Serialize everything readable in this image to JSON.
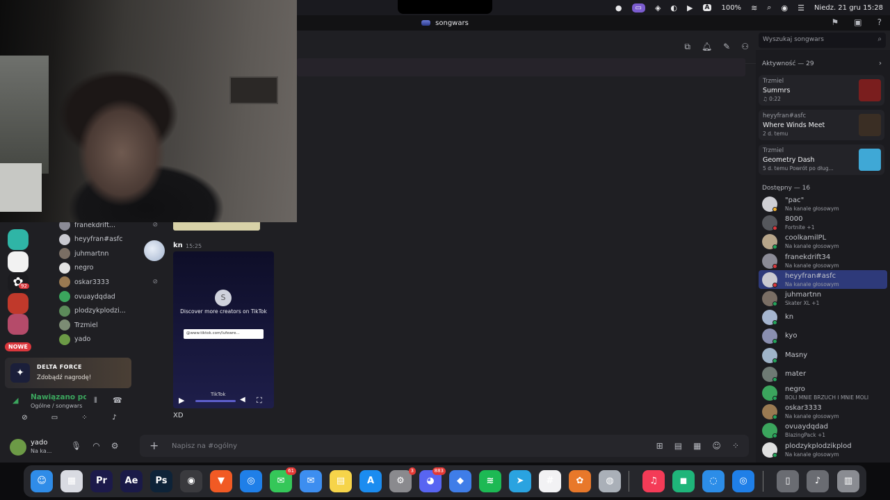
{
  "menubar": {
    "battery": "100%",
    "datetime": "Niedz. 21 gru  15:28",
    "input_source": "A"
  },
  "window": {
    "title": "songwars"
  },
  "search": {
    "placeholder": "Wyszukaj songwars"
  },
  "rail": {
    "badge": "92",
    "nowe": "NOWE"
  },
  "channel_members": [
    {
      "name": "franekdrift...",
      "muted": true,
      "color": "#8b8b96"
    },
    {
      "name": "heyyfran#asfc",
      "muted": false,
      "color": "#c9c9d0"
    },
    {
      "name": "juhmartnn",
      "muted": true,
      "color": "#7a6e64"
    },
    {
      "name": "negro",
      "muted": false,
      "color": "#e2e2e2"
    },
    {
      "name": "oskar3333",
      "muted": true,
      "color": "#9a7a52"
    },
    {
      "name": "ovuaydqdad",
      "muted": false,
      "color": "#3ba55d"
    },
    {
      "name": "plodzykplodzi...",
      "muted": false,
      "color": "#5c8a5a"
    },
    {
      "name": "Trzmiel",
      "muted": false,
      "color": "#7c8c74"
    },
    {
      "name": "yado",
      "muted": false,
      "color": "#6c9a46"
    }
  ],
  "ad": {
    "title": "DELTA FORCE",
    "subtitle": "Zdobądź nagrodę!"
  },
  "voice": {
    "status": "Nawiązano połą",
    "channel": "Ogólne / songwars"
  },
  "user": {
    "name": "yado",
    "status": "Na ka..."
  },
  "message": {
    "author": "kn",
    "time": "15:25",
    "video_heading": "Discover more creators on TikTok",
    "video_url": "@www.tiktok.com/lufewre...",
    "video_brand": "TikTok",
    "video_initial": "S",
    "text": "XD"
  },
  "composer": {
    "placeholder": "Napisz na #ogólny"
  },
  "activity": {
    "title": "Aktywność — 29",
    "cards": [
      {
        "who": "Trzmiel",
        "game": "Summrs",
        "meta": "♫ 0:22",
        "thumb": "#7a1e1e"
      },
      {
        "who": "heyyfran#asfc",
        "game": "Where Winds Meet",
        "meta": "2 d. temu",
        "thumb": "#3a2e24"
      },
      {
        "who": "Trzmiel",
        "game": "Geometry Dash",
        "meta": "5 d. temu   Powrót po dług...",
        "thumb": "#3fa8d6"
      }
    ]
  },
  "available": {
    "title": "Dostępny — 16",
    "members": [
      {
        "name": "\"pac\"",
        "status": "Na kanale głosowym",
        "color": "#cfcfd4",
        "dot": "#f0b232"
      },
      {
        "name": "8000",
        "status": "Fortnite +1",
        "color": "#55575c",
        "dot": "#da373c"
      },
      {
        "name": "coolkamilPL",
        "status": "Na kanale głosowym",
        "color": "#b7a58a",
        "dot": "#23a55a"
      },
      {
        "name": "franekdrift34",
        "status": "Na kanale głosowym",
        "color": "#8b8b96",
        "dot": "#da373c"
      },
      {
        "name": "heyyfran#asfc",
        "status": "Na kanale głosowym",
        "color": "#c9c9d0",
        "dot": "#da373c",
        "highlight": true
      },
      {
        "name": "juhmartnn",
        "status": "Skater XL +1",
        "color": "#7a6e64",
        "dot": "#23a55a"
      },
      {
        "name": "kn",
        "status": "",
        "color": "#a5b5cf",
        "dot": "#23a55a"
      },
      {
        "name": "kyo",
        "status": "",
        "color": "#8a8fb0",
        "dot": "#23a55a"
      },
      {
        "name": "Masny",
        "status": "",
        "color": "#9fb4c9",
        "dot": "#23a55a"
      },
      {
        "name": "mater",
        "status": "",
        "color": "#6e7a74",
        "dot": "#23a55a"
      },
      {
        "name": "negro",
        "status": "BOLI MNIE BRZUCH I MNIE MOLI",
        "color": "#3ba55d",
        "dot": "#23a55a"
      },
      {
        "name": "oskar3333",
        "status": "Na kanale głosowym",
        "color": "#9a7a52",
        "dot": "#23a55a"
      },
      {
        "name": "ovuaydqdad",
        "status": "BlazingPack +1",
        "color": "#3ba55d",
        "dot": "#23a55a"
      },
      {
        "name": "plodzykplodzikplod",
        "status": "Na kanale głosowym",
        "color": "#e0e0e0",
        "dot": "#23a55a"
      }
    ]
  },
  "dock": {
    "apps": [
      {
        "name": "finder",
        "label": "☺",
        "color": "#2f8ce8",
        "badge": ""
      },
      {
        "name": "launchpad",
        "label": "▦",
        "color": "#d9dbe2",
        "badge": ""
      },
      {
        "name": "premiere",
        "label": "Pr",
        "color": "#1c1a4a",
        "badge": ""
      },
      {
        "name": "after-effects",
        "label": "Ae",
        "color": "#1a1a48",
        "badge": ""
      },
      {
        "name": "photoshop",
        "label": "Ps",
        "color": "#0e2338",
        "badge": ""
      },
      {
        "name": "blender",
        "label": "◉",
        "color": "#3a3a3e",
        "badge": ""
      },
      {
        "name": "brave",
        "label": "▼",
        "color": "#f15a24",
        "badge": ""
      },
      {
        "name": "safari",
        "label": "◎",
        "color": "#1f7fe8",
        "badge": ""
      },
      {
        "name": "messages",
        "label": "✉",
        "color": "#35c759",
        "badge": "61"
      },
      {
        "name": "mail",
        "label": "✉",
        "color": "#3d8ef0",
        "badge": ""
      },
      {
        "name": "notes",
        "label": "▤",
        "color": "#f6d44a",
        "badge": ""
      },
      {
        "name": "app-store",
        "label": "A",
        "color": "#1b8cf0",
        "badge": ""
      },
      {
        "name": "system-settings",
        "label": "⚙",
        "color": "#8a8a8e",
        "badge": "3"
      },
      {
        "name": "discord",
        "label": "◕",
        "color": "#5865f2",
        "badge": "883"
      },
      {
        "name": "roblox",
        "label": "◆",
        "color": "#3f7de8",
        "badge": ""
      },
      {
        "name": "spotify",
        "label": "≋",
        "color": "#1db954",
        "badge": ""
      },
      {
        "name": "telegram",
        "label": "➤",
        "color": "#2aa3e0",
        "badge": ""
      },
      {
        "name": "slack",
        "label": "#",
        "color": "#f2f2f4",
        "badge": ""
      },
      {
        "name": "fl-studio",
        "label": "✿",
        "color": "#e8782a",
        "badge": ""
      },
      {
        "name": "disk-utility",
        "label": "◍",
        "color": "#aab0b8",
        "badge": ""
      },
      {
        "name": "music",
        "label": "♫",
        "color": "#f43b57",
        "badge": ""
      },
      {
        "name": "gamepad-app",
        "label": "◼",
        "color": "#1fb57a",
        "badge": ""
      },
      {
        "name": "pill-app",
        "label": "◌",
        "color": "#2c8de8",
        "badge": ""
      },
      {
        "name": "safari-2",
        "label": "◎",
        "color": "#1f7fe8",
        "badge": ""
      },
      {
        "name": "folder-docs",
        "label": "▯",
        "color": "#6a6c72",
        "badge": ""
      },
      {
        "name": "folder-music",
        "label": "♪",
        "color": "#6a6c72",
        "badge": ""
      },
      {
        "name": "trash",
        "label": "▥",
        "color": "#8a8c92",
        "badge": ""
      }
    ]
  }
}
